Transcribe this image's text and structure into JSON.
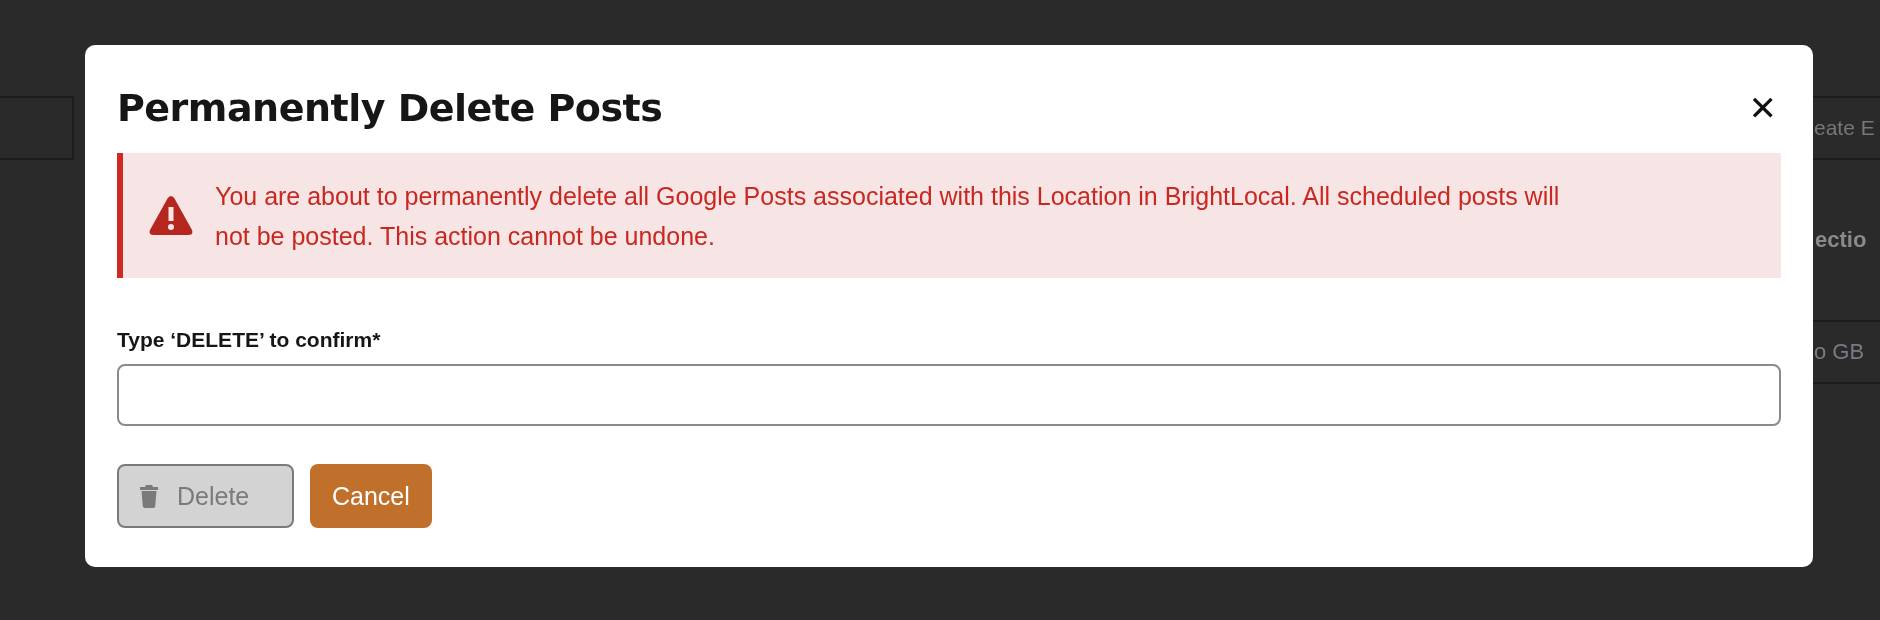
{
  "background": {
    "top_button": "eate E",
    "section_heading": "ectio",
    "bottom_button": "o GB"
  },
  "dialog": {
    "title": "Permanently Delete Posts",
    "close": "✕",
    "alert": {
      "message": "You are about to permanently delete all Google Posts associated with this Location in BrightLocal. All scheduled posts will not be posted. This action cannot be undone."
    },
    "field": {
      "label": "Type ‘DELETE’ to confirm*"
    },
    "buttons": [
      {
        "label": "Delete",
        "kind": "delete",
        "disabled": true
      },
      {
        "label": "Cancel",
        "kind": "cancel",
        "disabled": false
      }
    ]
  }
}
